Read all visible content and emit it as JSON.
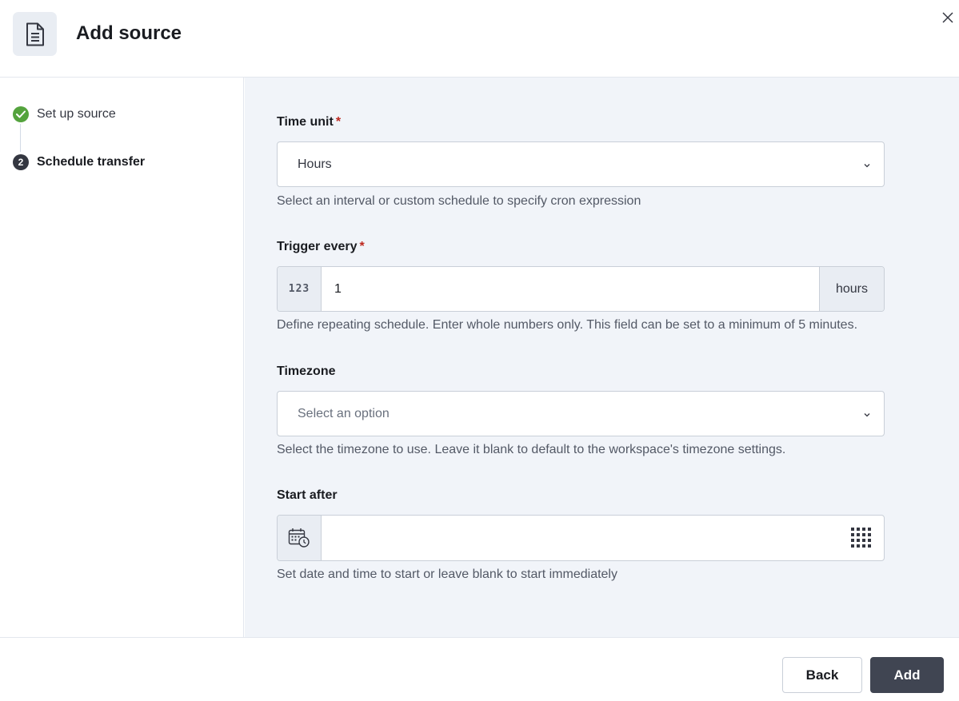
{
  "header": {
    "title": "Add source",
    "icon": "document-icon",
    "close_icon": "close-icon"
  },
  "steps": [
    {
      "label": "Set up source",
      "status": "complete",
      "icon": "check-icon"
    },
    {
      "label": "Schedule transfer",
      "status": "current",
      "number": "2"
    }
  ],
  "form": {
    "time_unit": {
      "label": "Time unit",
      "required": "*",
      "value": "Hours",
      "help": "Select an interval or custom schedule to specify cron expression"
    },
    "trigger_every": {
      "label": "Trigger every",
      "required": "*",
      "prepend": "123",
      "value": "1",
      "append": "hours",
      "help": "Define repeating schedule. Enter whole numbers only. This field can be set to a minimum of 5 minutes."
    },
    "timezone": {
      "label": "Timezone",
      "placeholder": "Select an option",
      "help": "Select the timezone to use. Leave it blank to default to the workspace's timezone settings."
    },
    "start_after": {
      "label": "Start after",
      "value": "",
      "prepend_icon": "calendar-clock-icon",
      "append_icon": "keypad-grid-icon",
      "help": "Set date and time to start or leave blank to start immediately"
    }
  },
  "footer": {
    "back_label": "Back",
    "add_label": "Add"
  },
  "colors": {
    "accent_dark": "#404552",
    "success": "#54a33d",
    "required": "#bd271e",
    "panel_bg": "#f1f4f9"
  }
}
